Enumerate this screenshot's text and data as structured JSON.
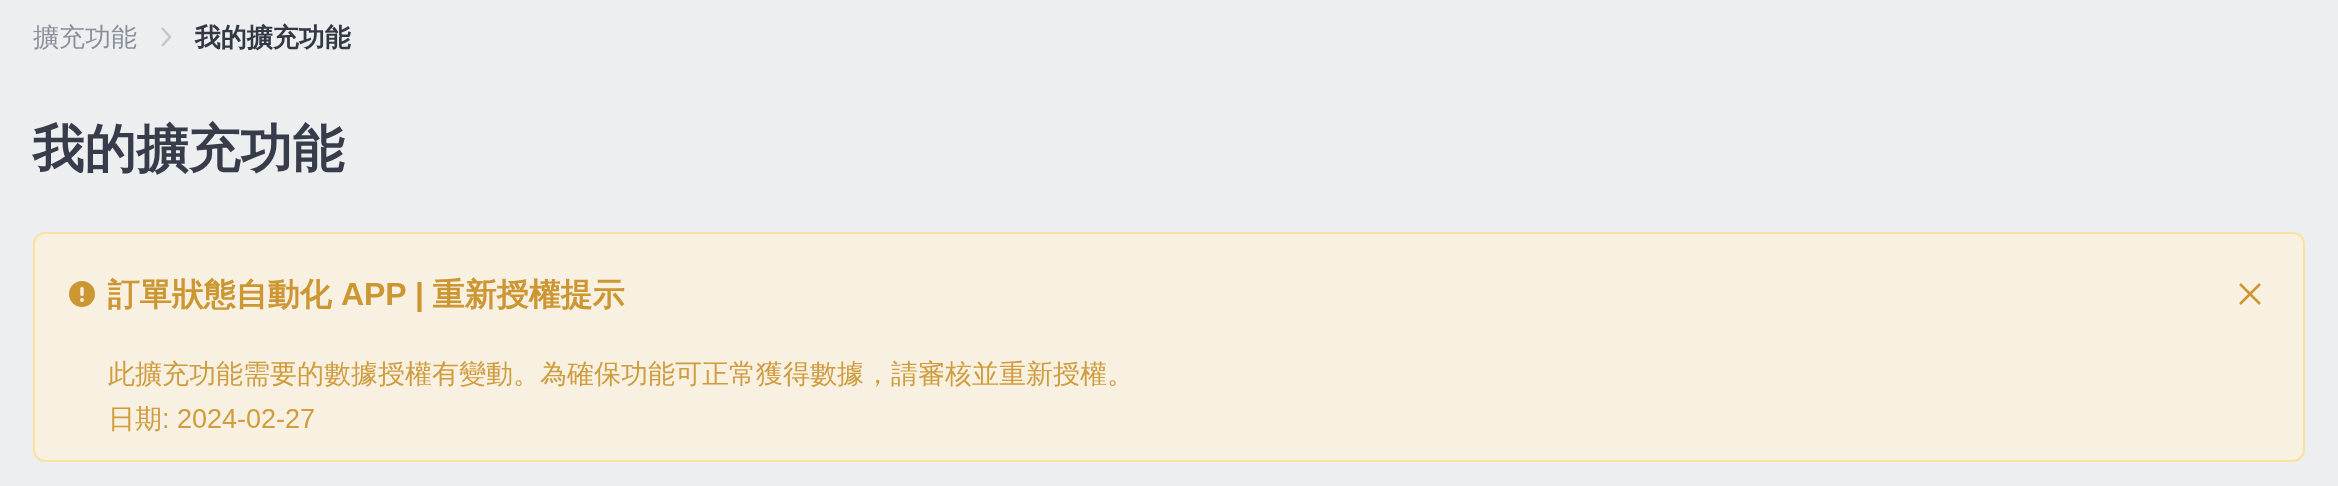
{
  "breadcrumb": [
    {
      "label": "擴充功能",
      "current": false
    },
    {
      "label": "我的擴充功能",
      "current": true
    }
  ],
  "page_title": "我的擴充功能",
  "alert": {
    "kind": "warning",
    "title": "訂單狀態自動化 APP | 重新授權提示",
    "message": "此擴充功能需要的數據授權有變動。為確保功能可正常獲得數據，請審核並重新授權。",
    "date": "日期: 2024-02-27",
    "dismissible": true
  }
}
